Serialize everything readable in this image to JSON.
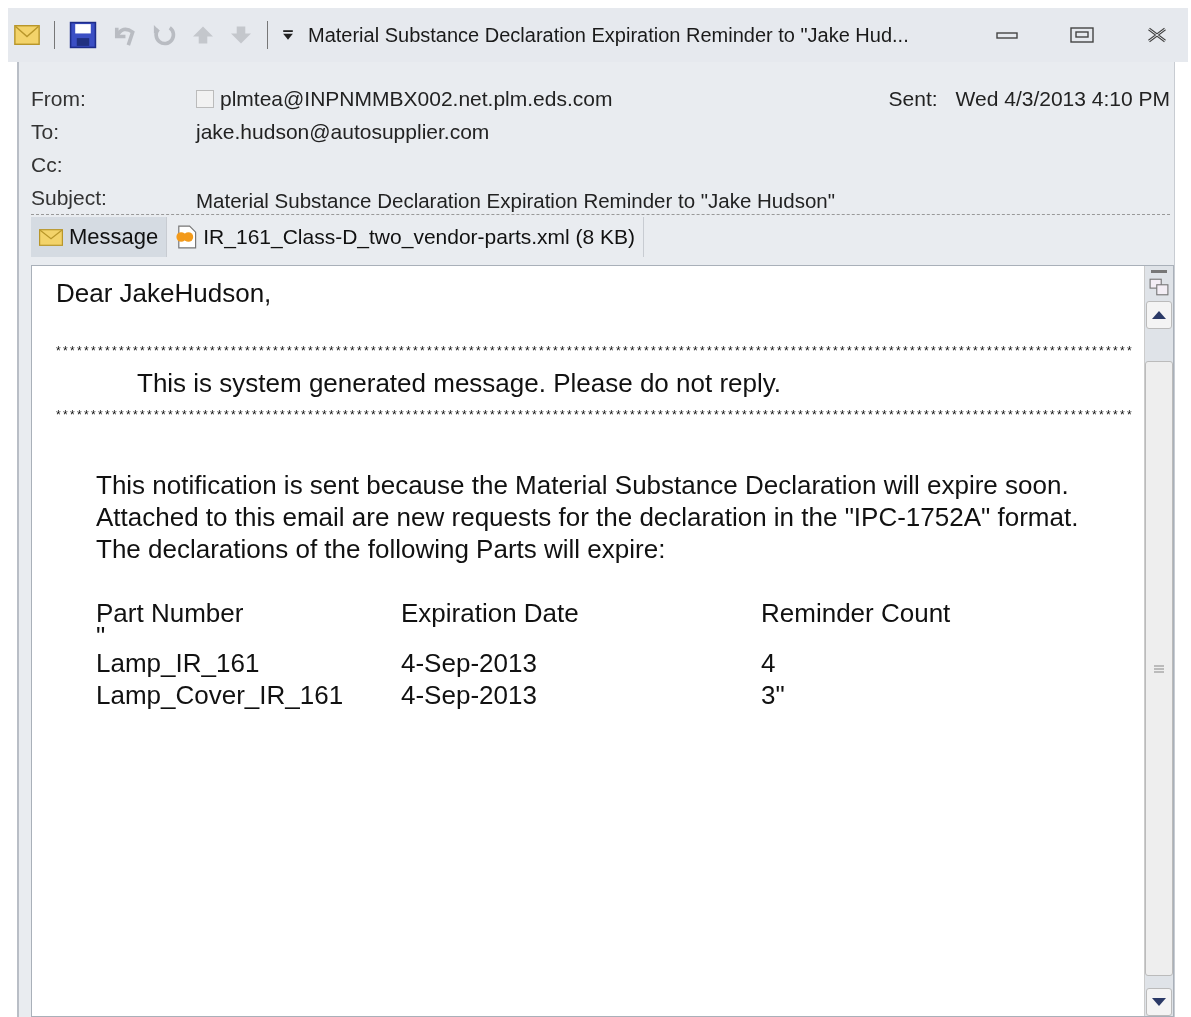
{
  "window": {
    "title": "Material Substance Declaration Expiration Reminder to \"Jake Hud..."
  },
  "header": {
    "from_label": "From:",
    "from": "plmtea@INPNMMBX002.net.plm.eds.com",
    "sent_label": "Sent:",
    "sent": "Wed 4/3/2013 4:10 PM",
    "to_label": "To:",
    "to": "jake.hudson@autosupplier.com",
    "cc_label": "Cc:",
    "subject_label": "Subject:",
    "subject": "Material Substance Declaration Expiration Reminder to \"Jake Hudson\""
  },
  "tabs": [
    {
      "label": "Message",
      "selected": true,
      "kind": "message"
    },
    {
      "label": "IR_161_Class-D_two_vendor-parts.xml (8 KB)",
      "selected": false,
      "kind": "attachment"
    }
  ],
  "body": {
    "greeting": "Dear JakeHudson,",
    "rule_top": "**********************************************************************************************************************************************************",
    "notice": "This is system generated message. Please do not reply.",
    "rule_bottom": "**********************************************************************************************************************************************************",
    "paragraph": [
      "This notification is sent because the Material Substance Declaration will expire soon.",
      "Attached to this email are new requests for the declaration in the \"IPC-1752A\" format.",
      "The declarations of the following Parts will expire:"
    ],
    "columns": [
      "Part Number",
      "Expiration Date",
      "Reminder Count"
    ],
    "quote_line": "\"",
    "rows": [
      [
        "Lamp_IR_161",
        "4-Sep-2013",
        "4"
      ],
      [
        "Lamp_Cover_IR_161",
        "4-Sep-2013",
        "3\""
      ]
    ]
  }
}
